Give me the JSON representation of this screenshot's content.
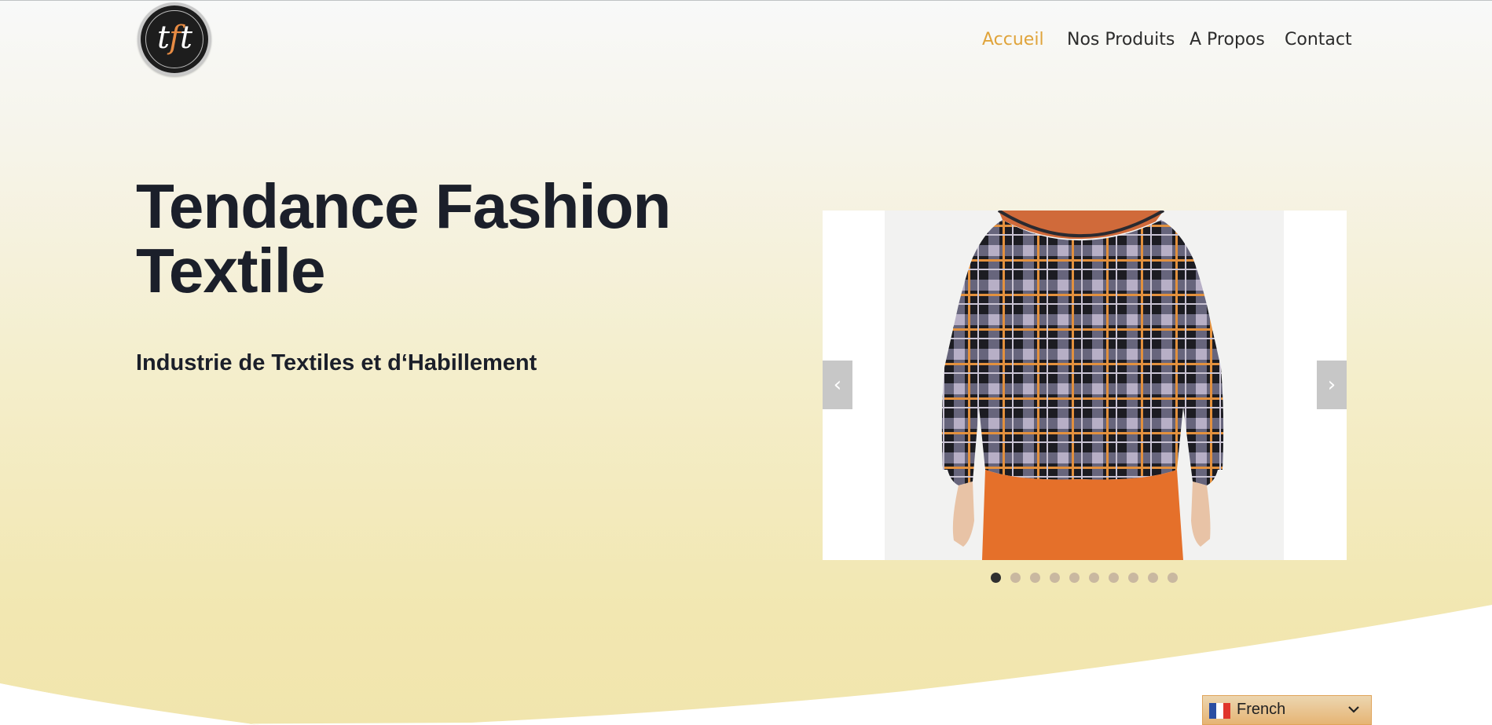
{
  "logo": {
    "text_t": "t",
    "text_f": "f",
    "text_t2": "t"
  },
  "nav": {
    "items": [
      {
        "label": "Accueil",
        "active": true
      },
      {
        "label": "Nos Produits",
        "active": false
      },
      {
        "label": "A Propos",
        "active": false
      },
      {
        "label": "Contact",
        "active": false
      }
    ]
  },
  "hero": {
    "title": "Tendance Fashion Textile",
    "subtitle": "Industrie de Textiles et d‘Habillement"
  },
  "slider": {
    "prev_icon": "chevron-left-icon",
    "next_icon": "chevron-right-icon",
    "prev_glyph": "‹",
    "next_glyph": "›",
    "slide_count": 10,
    "active_index": 0
  },
  "language": {
    "label": "French",
    "icon": "france-flag-icon"
  },
  "colors": {
    "accent": "#e0a43b",
    "heading": "#1b1f2a",
    "dot_inactive": "#c9b8a0",
    "dot_active": "#2f2f2f"
  }
}
